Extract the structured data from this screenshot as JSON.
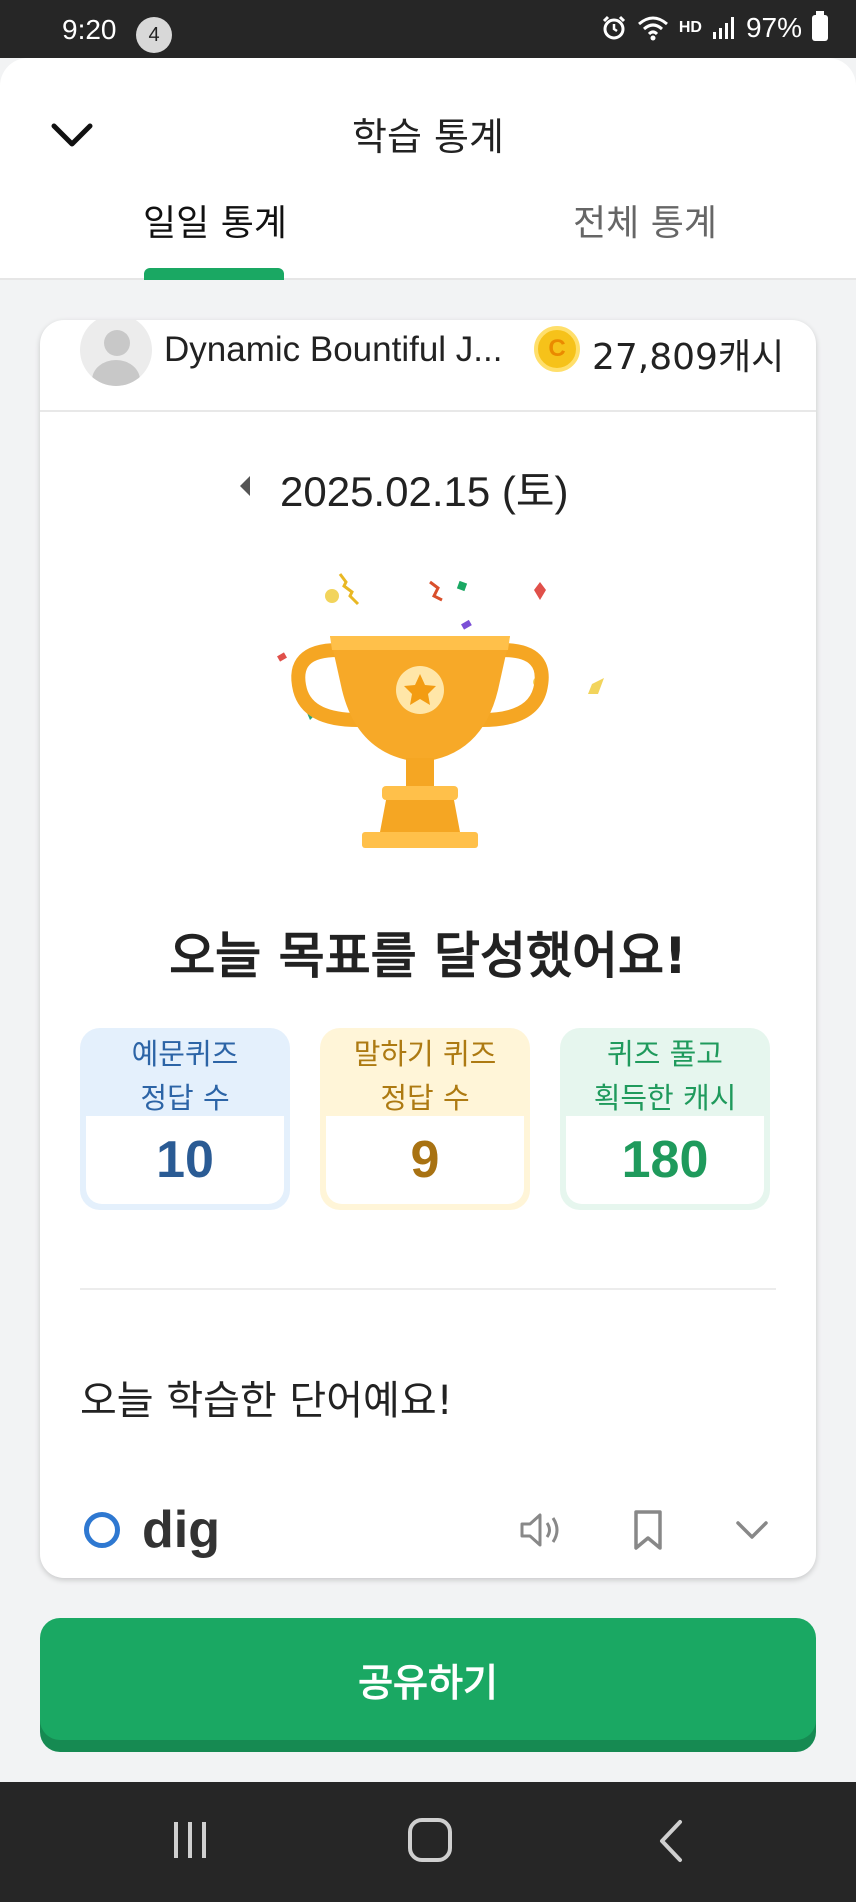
{
  "status_bar": {
    "time": "9:20",
    "notification_count": "4",
    "battery": "97%",
    "hd_label": "HD"
  },
  "header": {
    "title": "학습 통계",
    "tabs": [
      {
        "label": "일일 통계",
        "active": true
      },
      {
        "label": "전체 통계",
        "active": false
      }
    ]
  },
  "profile": {
    "user_name": "Dynamic Bountiful J...",
    "coin_symbol": "C",
    "cash": "27,809캐시"
  },
  "date": {
    "label": "2025.02.15 (토)"
  },
  "goal": {
    "message": "오늘 목표를 달성했어요!"
  },
  "stats": [
    {
      "line1": "예문퀴즈",
      "line2": "정답 수",
      "value": "10"
    },
    {
      "line1": "말하기 퀴즈",
      "line2": "정답 수",
      "value": "9"
    },
    {
      "line1": "퀴즈 풀고",
      "line2": "획득한 캐시",
      "value": "180"
    }
  ],
  "words": {
    "heading": "오늘 학습한 단어예요!",
    "items": [
      {
        "word": "dig"
      }
    ]
  },
  "actions": {
    "share_label": "공유하기"
  },
  "colors": {
    "accent": "#1aa863",
    "blue": "#2a5b94",
    "gold": "#a87212"
  }
}
